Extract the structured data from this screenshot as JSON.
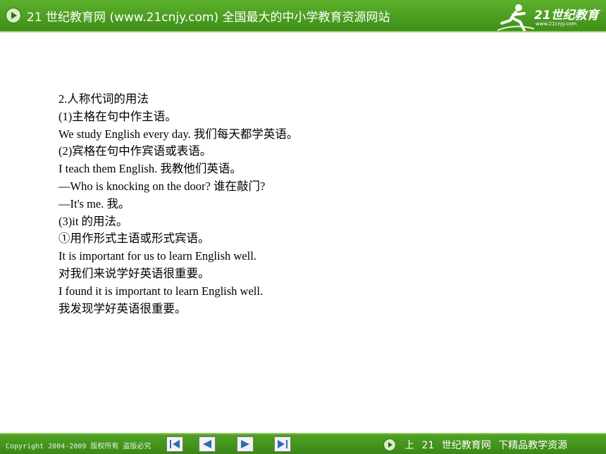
{
  "header": {
    "title": "21 世纪教育网 (www.21cnjy.com)  全国最大的中小学教育资源网站",
    "logo_text": "21世纪教育",
    "logo_url": "www.21cnjy.com"
  },
  "content": {
    "lines": [
      "2.人称代词的用法",
      "(1)主格在句中作主语。",
      "We study English every day.  我们每天都学英语。",
      "(2)宾格在句中作宾语或表语。",
      "I teach them English.  我教他们英语。",
      "—Who is knocking on the door?  谁在敲门?",
      "—It's me.  我。",
      "(3)it 的用法。",
      "①用作形式主语或形式宾语。",
      "It is important for us to learn English well.",
      "对我们来说学好英语很重要。",
      "I found it is important to learn English well.",
      "我发现学好英语很重要。"
    ]
  },
  "footer": {
    "copyright": "Copyright 2004-2009 版权所有 盗版必究",
    "slogan": "上 21 世纪教育网  下精品教学资源",
    "nav": [
      "first-icon",
      "previous-icon",
      "next-icon",
      "last-icon"
    ]
  },
  "colors": {
    "header_green": "#4a9f22",
    "footer_green": "#3f8f1a",
    "text": "#000000"
  }
}
